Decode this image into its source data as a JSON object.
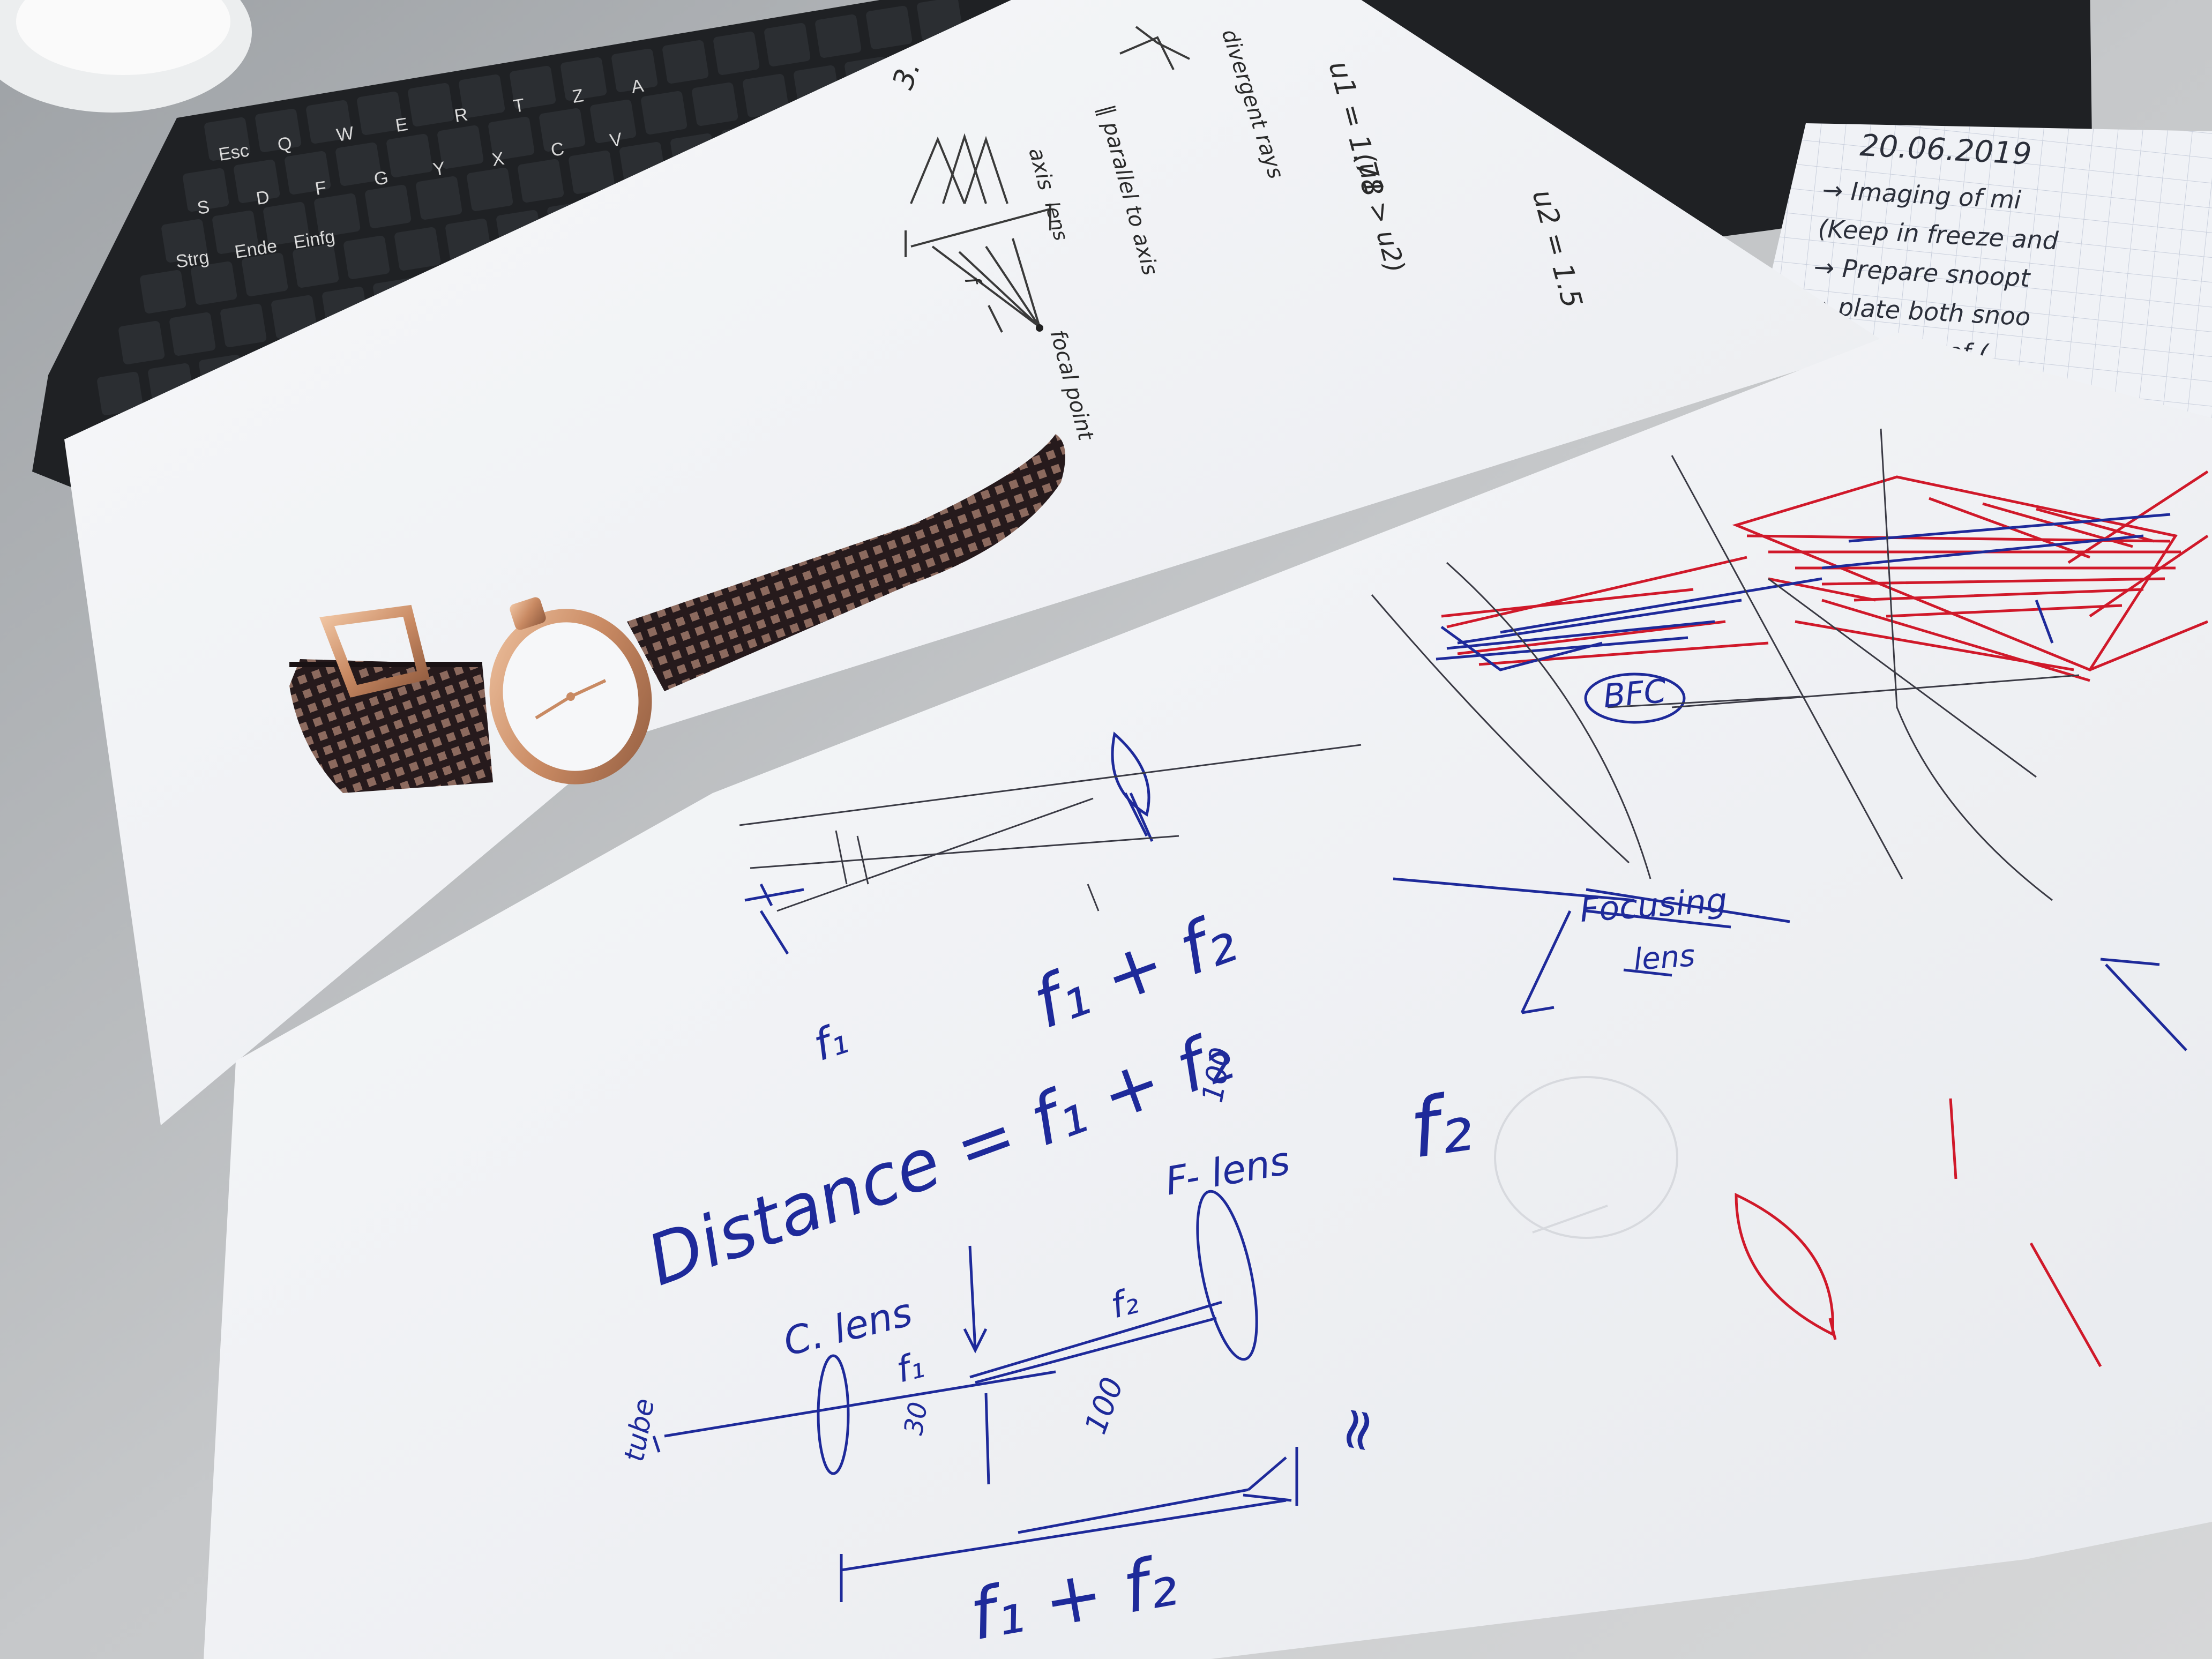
{
  "scene": {
    "description_free": true,
    "colors": {
      "desk": "#c4c6c8",
      "keyboard": "#1f2124",
      "paper": "#f4f5f7",
      "ink_blue": "#1e2a9a",
      "ink_red": "#d0192a",
      "pencil": "#2a2a2a",
      "watch_gold": "#d9a27c",
      "strap": "#2a1c1e"
    }
  },
  "keyboard": {
    "keys": [
      "Esc",
      "Q",
      "W",
      "E",
      "R",
      "T",
      "Z",
      "A",
      "S",
      "D",
      "F",
      "G",
      "Y",
      "X",
      "C",
      "V",
      "Strg",
      "Ende",
      "Einfg"
    ]
  },
  "notebook": {
    "date": "20.06.2019",
    "lines": [
      "→ Imaging of mi",
      "(Keep in freeze and",
      "→ Prepare snoopt",
      "→ plate both snoo",
      "→ Injection of ("
    ]
  },
  "pencil_sheet": {
    "labels": [
      "3.",
      "divergent rays",
      "u1 = 1.78",
      "u2 = 1.5",
      "(u1 > u2)",
      "∥ parallel to axis",
      "axis",
      "lens",
      "f",
      "focal point"
    ]
  },
  "blue_sheet": {
    "labels": {
      "bfc": "BFC",
      "focusing_1": "Focusing",
      "focusing_2": "lens",
      "f1": "f₁",
      "sum_formula": "f₁ + f₂",
      "distance": "Distance = f₁ + f₂",
      "hundred_top": "100",
      "f_lens": "F- lens",
      "f2_big": "f₂",
      "c_lens": "C. lens",
      "f1_small": "f₁",
      "f2_small": "f₂",
      "tube": "tube",
      "small_num": "30",
      "hundred_bottom": "100",
      "bottom_formula": "f₁ + f₂",
      "approx": "≈"
    }
  }
}
